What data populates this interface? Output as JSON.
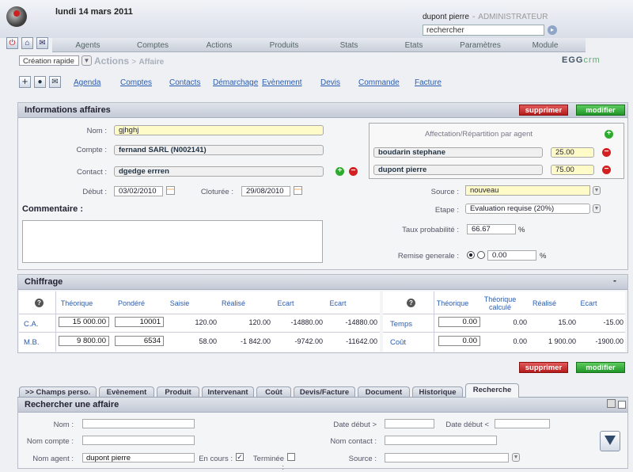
{
  "header": {
    "date": "lundi 14 mars 2011",
    "user": "dupont pierre",
    "role": "ADMINISTRATEUR",
    "search_value": "rechercher"
  },
  "nav": [
    "Agents",
    "Comptes",
    "Actions",
    "Produits",
    "Stats",
    "Etats",
    "Paramètres",
    "Module"
  ],
  "quick_create": "Création rapide",
  "breadcrumb": {
    "section": "Actions",
    "sep": ">",
    "page": "Affaire"
  },
  "brand": {
    "main": "EGG",
    "suffix": "crm"
  },
  "sublinks": [
    "Agenda",
    "Comptes",
    "Contacts",
    "Démarchage",
    "Evènement",
    "Devis",
    "Commande",
    "Facture"
  ],
  "buttons": {
    "delete": "supprimer",
    "edit": "modifier"
  },
  "info": {
    "title": "Informations affaires",
    "nom_label": "Nom :",
    "nom": "gjhghj",
    "compte_label": "Compte :",
    "compte": "fernand SARL  (N002141)",
    "contact_label": "Contact :",
    "contact": "dgedge errren",
    "debut_label": "Début :",
    "debut": "03/02/2010",
    "cloture_label": "Cloturée :",
    "cloture": "29/08/2010",
    "commentaire_label": "Commentaire :",
    "affectation_title": "Affectation/Répartition par agent",
    "agents": [
      {
        "name": "boudarin stephane",
        "pct": "25.00"
      },
      {
        "name": "dupont pierre",
        "pct": "75.00"
      }
    ],
    "source_label": "Source :",
    "source": "nouveau",
    "etape_label": "Etape :",
    "etape": "Evaluation requise (20%)",
    "taux_label": "Taux probabilité :",
    "taux": "66.67",
    "taux_unit": "%",
    "remise_label": "Remise generale :",
    "remise": "0.00",
    "remise_unit": "%"
  },
  "chiffrage": {
    "title": "Chiffrage",
    "collapse": "-",
    "left_headers": [
      "Théorique",
      "Pondéré",
      "Saisie",
      "Réalisé",
      "Ecart",
      "Ecart"
    ],
    "left_rows": [
      {
        "label": "C.A.",
        "theorique": "15 000.00",
        "pondere": "10001",
        "saisie": "120.00",
        "realise": "120.00",
        "ecart1": "-14880.00",
        "ecart2": "-14880.00"
      },
      {
        "label": "M.B.",
        "theorique": "9 800.00",
        "pondere": "6534",
        "saisie": "58.00",
        "realise": "-1 842.00",
        "ecart1": "-9742.00",
        "ecart2": "-11642.00"
      }
    ],
    "right_headers": [
      "Théorique",
      "Théorique calculé",
      "Réalisé",
      "Ecart"
    ],
    "right_rows": [
      {
        "label": "Temps",
        "theorique": "0.00",
        "calcule": "0.00",
        "realise": "15.00",
        "ecart": "-15.00"
      },
      {
        "label": "Coût",
        "theorique": "0.00",
        "calcule": "0.00",
        "realise": "1 900.00",
        "ecart": "-1900.00"
      }
    ]
  },
  "tabs": [
    ">> Champs perso.",
    "Evènement",
    "Produit",
    "Intervenant",
    "Coût",
    "Devis/Facture",
    "Document",
    "Historique",
    "Recherche"
  ],
  "search_panel": {
    "title": "Rechercher une affaire",
    "nom_label": "Nom :",
    "nom_compte_label": "Nom compte :",
    "nom_agent_label": "Nom agent :",
    "nom_agent": "dupont pierre",
    "en_cours_label": "En cours :",
    "terminee_label": "Terminée :",
    "date_debut_gt_label": "Date début >",
    "date_debut_lt_label": "Date début <",
    "nom_contact_label": "Nom contact :",
    "source_label": "Source :"
  }
}
